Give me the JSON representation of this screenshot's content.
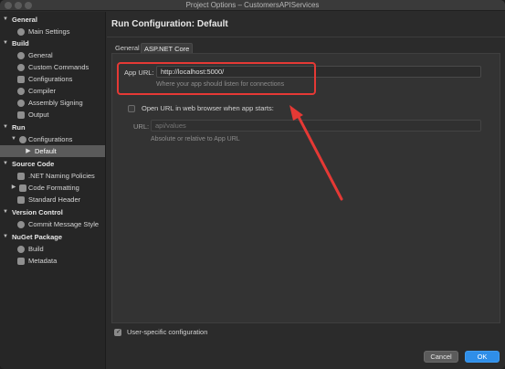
{
  "window": {
    "title": "Project Options – CustomersAPIServices"
  },
  "sidebar": {
    "groups": [
      {
        "label": "General",
        "items": [
          {
            "label": "Main Settings"
          }
        ]
      },
      {
        "label": "Build",
        "items": [
          {
            "label": "General"
          },
          {
            "label": "Custom Commands"
          },
          {
            "label": "Configurations"
          },
          {
            "label": "Compiler"
          },
          {
            "label": "Assembly Signing"
          },
          {
            "label": "Output"
          }
        ]
      },
      {
        "label": "Run",
        "items": [
          {
            "label": "Configurations"
          },
          {
            "label": "Default",
            "selected": true
          }
        ]
      },
      {
        "label": "Source Code",
        "items": [
          {
            "label": ".NET Naming Policies"
          },
          {
            "label": "Code Formatting"
          },
          {
            "label": "Standard Header"
          }
        ]
      },
      {
        "label": "Version Control",
        "items": [
          {
            "label": "Commit Message Style"
          }
        ]
      },
      {
        "label": "NuGet Package",
        "items": [
          {
            "label": "Build"
          },
          {
            "label": "Metadata"
          }
        ]
      }
    ]
  },
  "main": {
    "heading": "Run Configuration: Default",
    "tabs": [
      {
        "label": "General",
        "active": false
      },
      {
        "label": "ASP.NET Core",
        "active": true
      }
    ],
    "app_url": {
      "label": "App URL:",
      "value": "http://localhost:5000/",
      "hint": "Where your app should listen for connections"
    },
    "open_browser": {
      "label": "Open URL in web browser when app starts:",
      "checked": false
    },
    "url": {
      "label": "URL:",
      "placeholder": "api/values",
      "hint": "Absolute or relative to App URL"
    },
    "user_specific": {
      "label": "User-specific configuration",
      "checked": true
    }
  },
  "footer": {
    "cancel_label": "Cancel",
    "ok_label": "OK"
  },
  "colors": {
    "annotation": "#e53935",
    "primary_button": "#2f8ee8"
  }
}
